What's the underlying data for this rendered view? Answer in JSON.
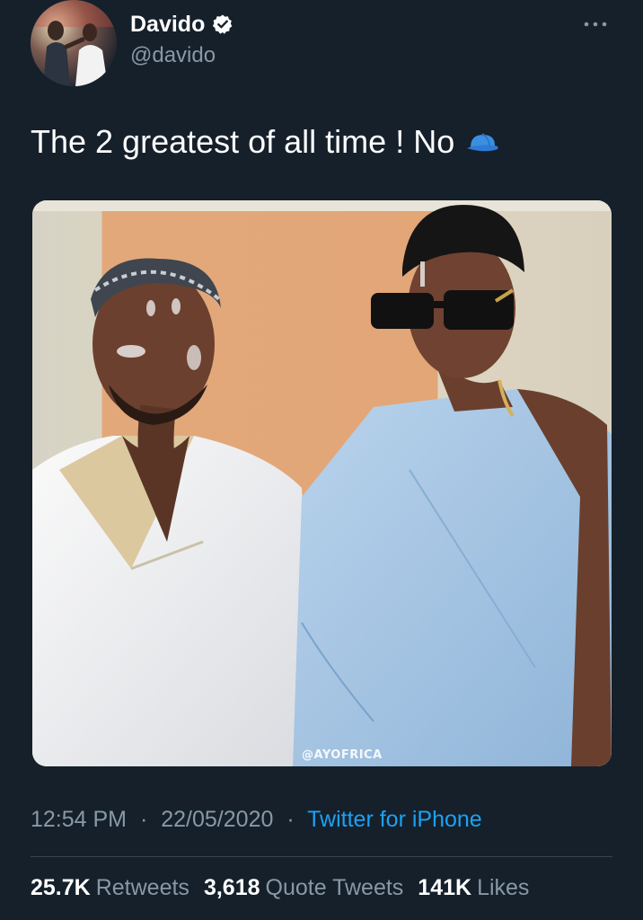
{
  "author": {
    "display_name": "Davido",
    "handle": "@davido",
    "verified": true,
    "avatar_icon": "profile-photo"
  },
  "tweet": {
    "text": "The 2 greatest of all time ! No",
    "emoji_icon": "billed-cap-emoji",
    "image_watermark": "@AYOFRICA"
  },
  "meta": {
    "time": "12:54 PM",
    "date": "22/05/2020",
    "separator": "·",
    "source": "Twitter for iPhone"
  },
  "stats": {
    "retweets": {
      "count": "25.7K",
      "label": "Retweets"
    },
    "quote_tweets": {
      "count": "3,618",
      "label": "Quote Tweets"
    },
    "likes": {
      "count": "141K",
      "label": "Likes"
    }
  },
  "colors": {
    "background": "#15202b",
    "secondary_text": "#8899a6",
    "accent": "#1da1f2",
    "divider": "#38444d"
  }
}
